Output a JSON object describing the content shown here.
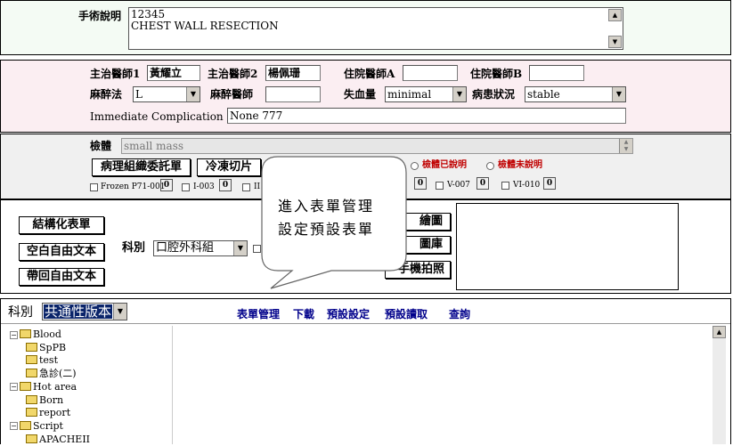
{
  "surgery": {
    "label": "手術說明",
    "line1": "12345",
    "line2": "CHEST WALL RESECTION"
  },
  "staff": {
    "attending1_label": "主治醫師1",
    "attending1_value": "黃耀立",
    "attending2_label": "主治醫師2",
    "attending2_value": "楊佩珊",
    "residentA_label": "住院醫師A",
    "residentA_value": "",
    "residentB_label": "住院醫師B",
    "residentB_value": "",
    "anesthesia_label": "麻醉法",
    "anesthesia_value": "L",
    "anesthetist_label": "麻醉醫師",
    "anesthetist_value": "",
    "blood_loss_label": "失血量",
    "blood_loss_value": "minimal",
    "condition_label": "病患狀況",
    "condition_value": "stable",
    "complication_label": "Immediate Complication",
    "complication_value": "None 777"
  },
  "specimen": {
    "label": "檢體",
    "value": "small mass",
    "pathology_button": "病理組織委託單",
    "frozen_button": "冷凍切片",
    "radio_explained": "檢體已說明",
    "radio_not_explained": "檢體未說明",
    "checks": [
      {
        "label": "Frozen P71-001",
        "count": "0"
      },
      {
        "label": "I-003",
        "count": "0"
      },
      {
        "label": "II",
        "count": ""
      },
      {
        "label": "",
        "count": "0"
      },
      {
        "label": "V-007",
        "count": "0"
      },
      {
        "label": "VI-010",
        "count": "0"
      }
    ]
  },
  "actions": {
    "structured_form": "結構化表單",
    "blank_text": "空白自由文本",
    "bring_text": "帶回自由文本",
    "dept_label": "科別",
    "dept_value": "口腔外科組",
    "draw_btn": "繪圖",
    "gallery_btn": "圖庫",
    "photo_btn": "手機拍照"
  },
  "callout": {
    "line1": "進入表單管理",
    "line2": "設定預設表單"
  },
  "bottom": {
    "dept_label": "科別",
    "dept_value": "共通性版本",
    "links": [
      "表單管理",
      "下載",
      "預設設定",
      "預設讀取",
      "查詢"
    ]
  },
  "tree": [
    {
      "level": 0,
      "expander": "−",
      "label": "Blood"
    },
    {
      "level": 1,
      "label": "SpPB"
    },
    {
      "level": 1,
      "label": "test"
    },
    {
      "level": 1,
      "label": "急診(二)"
    },
    {
      "level": 0,
      "expander": "−",
      "label": "Hot area"
    },
    {
      "level": 1,
      "label": "Born"
    },
    {
      "level": 1,
      "label": "report"
    },
    {
      "level": 0,
      "expander": "−",
      "label": "Script"
    },
    {
      "level": 1,
      "label": "APACHEII"
    }
  ]
}
